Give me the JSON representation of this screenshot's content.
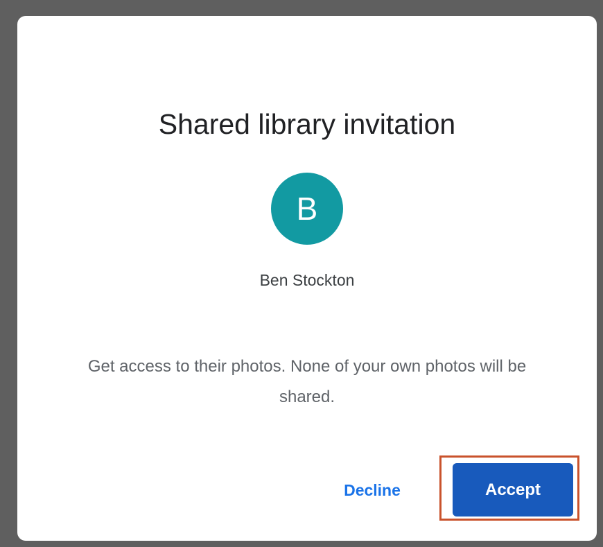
{
  "dialog": {
    "title": "Shared library invitation",
    "avatar_initial": "B",
    "sender_name": "Ben Stockton",
    "message": "Get access to their photos. None of your own photos will be shared.",
    "decline_label": "Decline",
    "accept_label": "Accept"
  },
  "colors": {
    "avatar_bg": "#129aa2",
    "accent": "#1a73e8",
    "accept_bg": "#185abc",
    "highlight": "#c9522c"
  }
}
